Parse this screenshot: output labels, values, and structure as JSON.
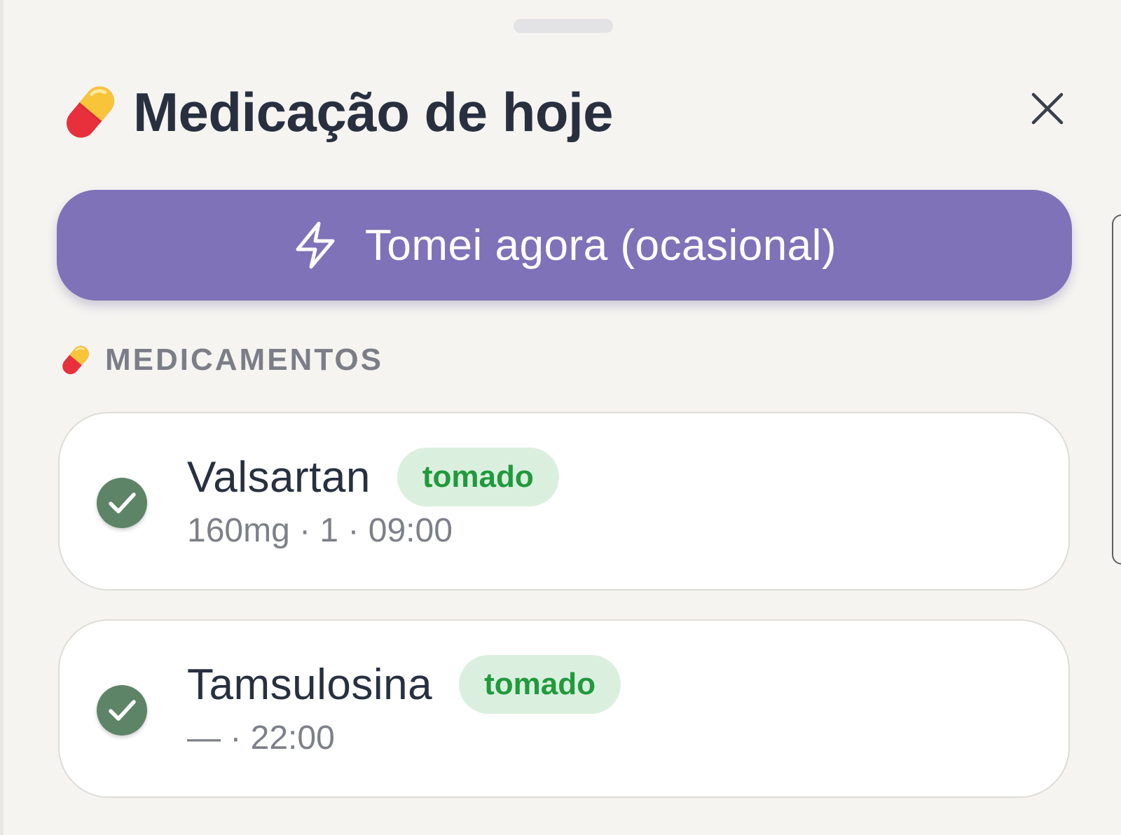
{
  "sheet": {
    "title": "Medicação de hoje",
    "title_icon": "pill-emoji-icon",
    "close_icon": "close-icon"
  },
  "quick_action": {
    "label": "Tomei agora (ocasional)",
    "icon": "lightning-icon",
    "color": "#7f72b8"
  },
  "section": {
    "label": "MEDICAMENTOS",
    "icon": "pill-emoji-icon"
  },
  "medications": [
    {
      "name": "Valsartan",
      "status": "tomado",
      "details": "160mg · 1 · 09:00",
      "checked": true
    },
    {
      "name": "Tamsulosina",
      "status": "tomado",
      "details": "— · 22:00",
      "checked": true
    }
  ],
  "colors": {
    "check": "#5e8467",
    "badge_bg": "#dbefdf",
    "badge_text": "#1f9a3c",
    "title": "#283040"
  }
}
